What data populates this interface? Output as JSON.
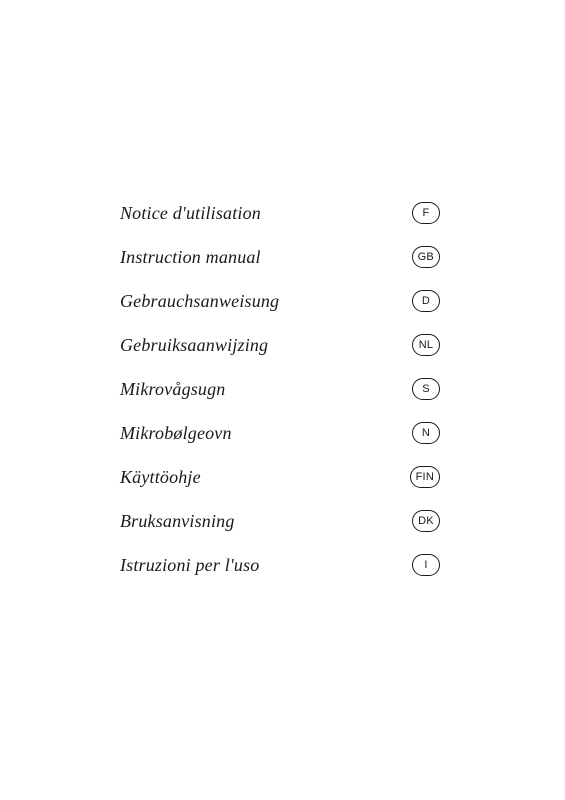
{
  "entries": [
    {
      "id": "french",
      "label": "Notice d'utilisation",
      "badge": "F",
      "badge_type": "oval"
    },
    {
      "id": "english",
      "label": "Instruction manual",
      "badge": "GB",
      "badge_type": "oval"
    },
    {
      "id": "german",
      "label": "Gebrauchsanweisung",
      "badge": "D",
      "badge_type": "oval"
    },
    {
      "id": "dutch",
      "label": "Gebruiksaanwijzing",
      "badge": "NL",
      "badge_type": "oval"
    },
    {
      "id": "swedish",
      "label": "Mikrovågsugn",
      "badge": "S",
      "badge_type": "oval"
    },
    {
      "id": "norwegian",
      "label": "Mikrobølgeovn",
      "badge": "N",
      "badge_type": "oval"
    },
    {
      "id": "finnish",
      "label": "Käyttöohje",
      "badge": "FIN",
      "badge_type": "oval"
    },
    {
      "id": "danish",
      "label": "Bruksanvisning",
      "badge": "DK",
      "badge_type": "oval"
    },
    {
      "id": "italian",
      "label": "Istruzioni per l'uso",
      "badge": "I",
      "badge_type": "oval"
    }
  ]
}
